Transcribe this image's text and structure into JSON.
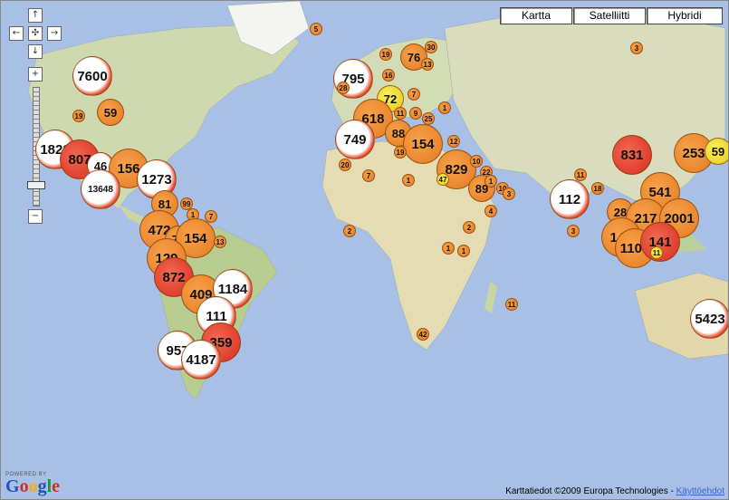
{
  "controls": {
    "pan_up": "↑",
    "pan_left": "←",
    "pan_center": "✣",
    "pan_right": "→",
    "pan_down": "↓",
    "zoom_in": "+",
    "zoom_out": "−",
    "zoom_level_fraction": 0.3
  },
  "map_types": [
    "Kartta",
    "Satelliitti",
    "Hybridi"
  ],
  "selected_map_type": "Kartta",
  "branding": {
    "powered_by": "POWERED BY",
    "logo": "Google"
  },
  "footer": {
    "attribution": "Karttatiedot ©2009 Europa Technologies - ",
    "terms_link": "Käyttöehdot"
  },
  "clusters": [
    {
      "label": "7600",
      "size": "large",
      "color": "white"
    },
    {
      "label": "5",
      "size": "small",
      "color": "orange"
    },
    {
      "label": "19",
      "size": "small",
      "color": "orange"
    },
    {
      "label": "59",
      "size": "medium",
      "color": "orange"
    },
    {
      "label": "1823",
      "size": "large",
      "color": "white"
    },
    {
      "label": "807",
      "size": "large",
      "color": "red"
    },
    {
      "label": "46",
      "size": "medium",
      "color": "white"
    },
    {
      "label": "156",
      "size": "large",
      "color": "orange"
    },
    {
      "label": "1273",
      "size": "large",
      "color": "white"
    },
    {
      "label": "13648",
      "size": "large",
      "color": "white"
    },
    {
      "label": "81",
      "size": "medium",
      "color": "orange"
    },
    {
      "label": "99",
      "size": "small",
      "color": "orange"
    },
    {
      "label": "1",
      "size": "small",
      "color": "orange"
    },
    {
      "label": "7",
      "size": "small",
      "color": "orange"
    },
    {
      "label": "472",
      "size": "large",
      "color": "orange"
    },
    {
      "label": "74",
      "size": "medium",
      "color": "orange"
    },
    {
      "label": "154",
      "size": "large",
      "color": "orange"
    },
    {
      "label": "13",
      "size": "small",
      "color": "orange"
    },
    {
      "label": "129",
      "size": "large",
      "color": "orange"
    },
    {
      "label": "872",
      "size": "large",
      "color": "red"
    },
    {
      "label": "409",
      "size": "large",
      "color": "orange"
    },
    {
      "label": "1184",
      "size": "large",
      "color": "white"
    },
    {
      "label": "111",
      "size": "large",
      "color": "white"
    },
    {
      "label": "957",
      "size": "large",
      "color": "white"
    },
    {
      "label": "359",
      "size": "large",
      "color": "red"
    },
    {
      "label": "4187",
      "size": "large",
      "color": "white"
    },
    {
      "label": "795",
      "size": "large",
      "color": "white"
    },
    {
      "label": "19",
      "size": "small",
      "color": "orange"
    },
    {
      "label": "76",
      "size": "medium",
      "color": "orange"
    },
    {
      "label": "30",
      "size": "small",
      "color": "orange"
    },
    {
      "label": "13",
      "size": "small",
      "color": "orange"
    },
    {
      "label": "28",
      "size": "small",
      "color": "orange"
    },
    {
      "label": "16",
      "size": "small",
      "color": "orange"
    },
    {
      "label": "72",
      "size": "medium",
      "color": "yellow"
    },
    {
      "label": "7",
      "size": "small",
      "color": "orange"
    },
    {
      "label": "618",
      "size": "large",
      "color": "orange"
    },
    {
      "label": "11",
      "size": "small",
      "color": "orange"
    },
    {
      "label": "9",
      "size": "small",
      "color": "orange"
    },
    {
      "label": "25",
      "size": "small",
      "color": "orange"
    },
    {
      "label": "1",
      "size": "small",
      "color": "orange"
    },
    {
      "label": "40",
      "size": "small",
      "color": "orange"
    },
    {
      "label": "749",
      "size": "large",
      "color": "white"
    },
    {
      "label": "88",
      "size": "medium",
      "color": "orange"
    },
    {
      "label": "154",
      "size": "large",
      "color": "orange"
    },
    {
      "label": "12",
      "size": "small",
      "color": "orange"
    },
    {
      "label": "19",
      "size": "small",
      "color": "orange"
    },
    {
      "label": "20",
      "size": "small",
      "color": "orange"
    },
    {
      "label": "7",
      "size": "small",
      "color": "orange"
    },
    {
      "label": "1",
      "size": "small",
      "color": "orange"
    },
    {
      "label": "829",
      "size": "large",
      "color": "orange"
    },
    {
      "label": "10",
      "size": "small",
      "color": "orange"
    },
    {
      "label": "47",
      "size": "small",
      "color": "yellow"
    },
    {
      "label": "22",
      "size": "small",
      "color": "orange"
    },
    {
      "label": "89",
      "size": "medium",
      "color": "orange"
    },
    {
      "label": "1",
      "size": "small",
      "color": "orange"
    },
    {
      "label": "10",
      "size": "small",
      "color": "orange"
    },
    {
      "label": "3",
      "size": "small",
      "color": "orange"
    },
    {
      "label": "4",
      "size": "small",
      "color": "orange"
    },
    {
      "label": "2",
      "size": "small",
      "color": "orange"
    },
    {
      "label": "2",
      "size": "small",
      "color": "orange"
    },
    {
      "label": "1",
      "size": "small",
      "color": "orange"
    },
    {
      "label": "1",
      "size": "small",
      "color": "orange"
    },
    {
      "label": "11",
      "size": "small",
      "color": "orange"
    },
    {
      "label": "42",
      "size": "small",
      "color": "orange"
    },
    {
      "label": "831",
      "size": "large",
      "color": "red"
    },
    {
      "label": "253",
      "size": "large",
      "color": "orange"
    },
    {
      "label": "59",
      "size": "medium",
      "color": "yellow"
    },
    {
      "label": "3",
      "size": "small",
      "color": "orange"
    },
    {
      "label": "11",
      "size": "small",
      "color": "orange"
    },
    {
      "label": "112",
      "size": "large",
      "color": "white"
    },
    {
      "label": "18",
      "size": "small",
      "color": "orange"
    },
    {
      "label": "3",
      "size": "small",
      "color": "orange"
    },
    {
      "label": "541",
      "size": "large",
      "color": "orange"
    },
    {
      "label": "28",
      "size": "medium",
      "color": "orange"
    },
    {
      "label": "217",
      "size": "large",
      "color": "orange"
    },
    {
      "label": "2001",
      "size": "large",
      "color": "orange"
    },
    {
      "label": "146",
      "size": "large",
      "color": "orange"
    },
    {
      "label": "1109",
      "size": "large",
      "color": "orange"
    },
    {
      "label": "141",
      "size": "large",
      "color": "red"
    },
    {
      "label": "11",
      "size": "small",
      "color": "yellow"
    },
    {
      "label": "5423",
      "size": "large",
      "color": "white"
    }
  ],
  "colors": {
    "ocean": "#a9c0e6",
    "land": "#e6e2cf",
    "land_green": "#b9cf9c",
    "cluster_orange": "#f0922e",
    "cluster_red": "#e5352a",
    "cluster_white": "#ffffff",
    "cluster_yellow": "#f5e426"
  }
}
